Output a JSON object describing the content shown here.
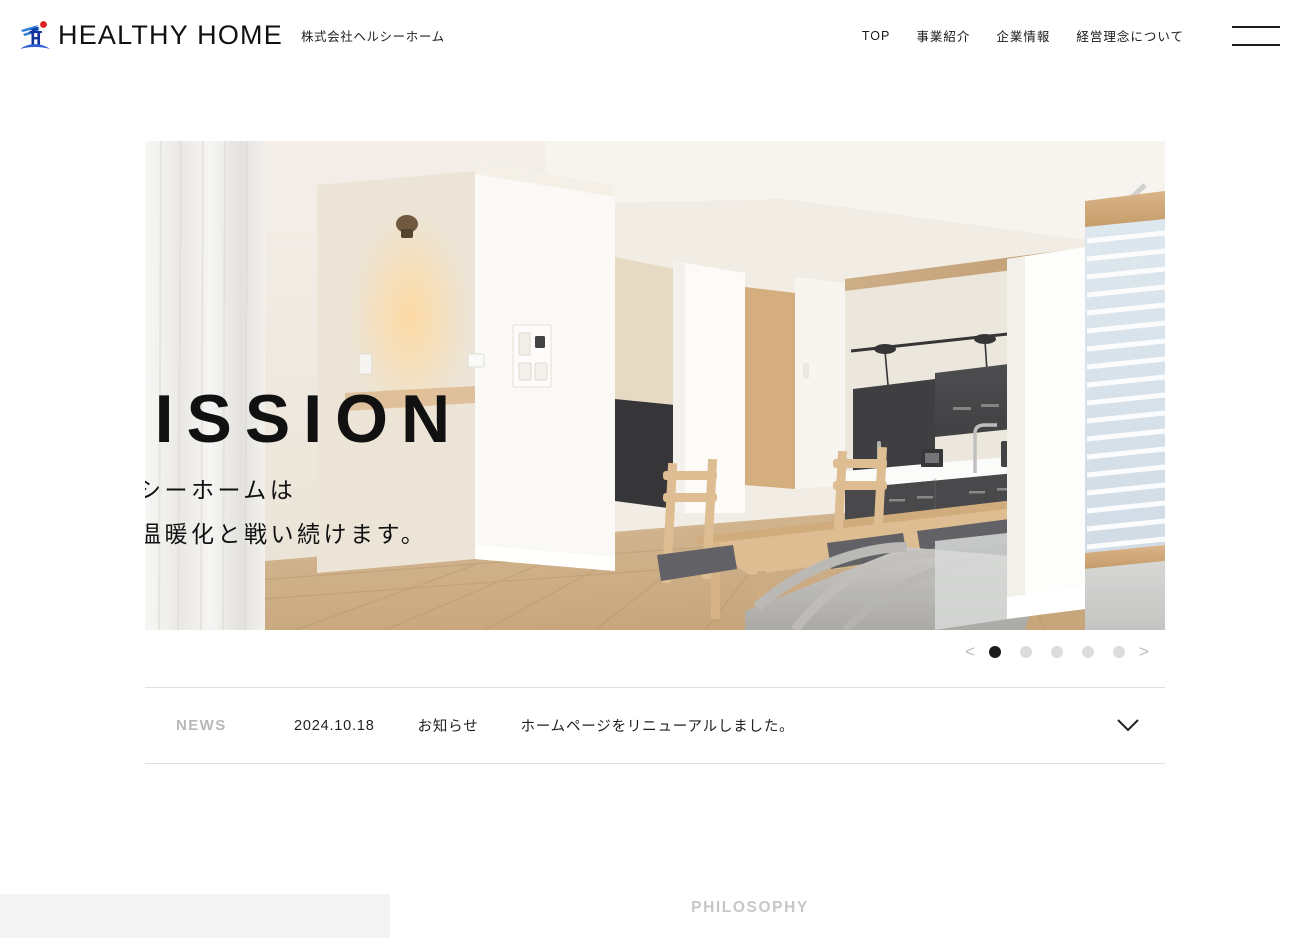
{
  "header": {
    "brand_name": "HEALTHY HOME",
    "brand_sub": "株式会社ヘルシーホーム",
    "logo_icon": "house-bird-logo-icon",
    "nav": [
      {
        "label": "TOP",
        "name": "nav-item-top"
      },
      {
        "label": "事業紹介",
        "name": "nav-item-business"
      },
      {
        "label": "企業情報",
        "name": "nav-item-company"
      },
      {
        "label": "経営理念について",
        "name": "nav-item-philosophy"
      }
    ],
    "menu_icon": "hamburger-menu-icon"
  },
  "hero": {
    "title": "MISSION",
    "line1": "ヘルシーホームは",
    "line2": "地球温暖化と戦い続けます。",
    "image_alt": "modern-house-interior-kitchen-dining"
  },
  "carousel": {
    "prev_icon": "chevron-left-icon",
    "next_icon": "chevron-right-icon",
    "prev_label": "<",
    "next_label": ">",
    "slide_count": 5,
    "active_index": 0
  },
  "news": {
    "label": "NEWS",
    "date": "2024.10.18",
    "category": "お知らせ",
    "title": "ホームページをリニューアルしました。",
    "expand_icon": "chevron-down-icon"
  },
  "philosophy": {
    "title": "PHILOSOPHY"
  },
  "colors": {
    "accent_blue": "#2b4fc4",
    "accent_red": "#e02020",
    "text_dark": "#111111",
    "muted_gray": "#b8b8b8",
    "divider": "#e0e0e0",
    "panel_gray": "#f4f4f4"
  }
}
